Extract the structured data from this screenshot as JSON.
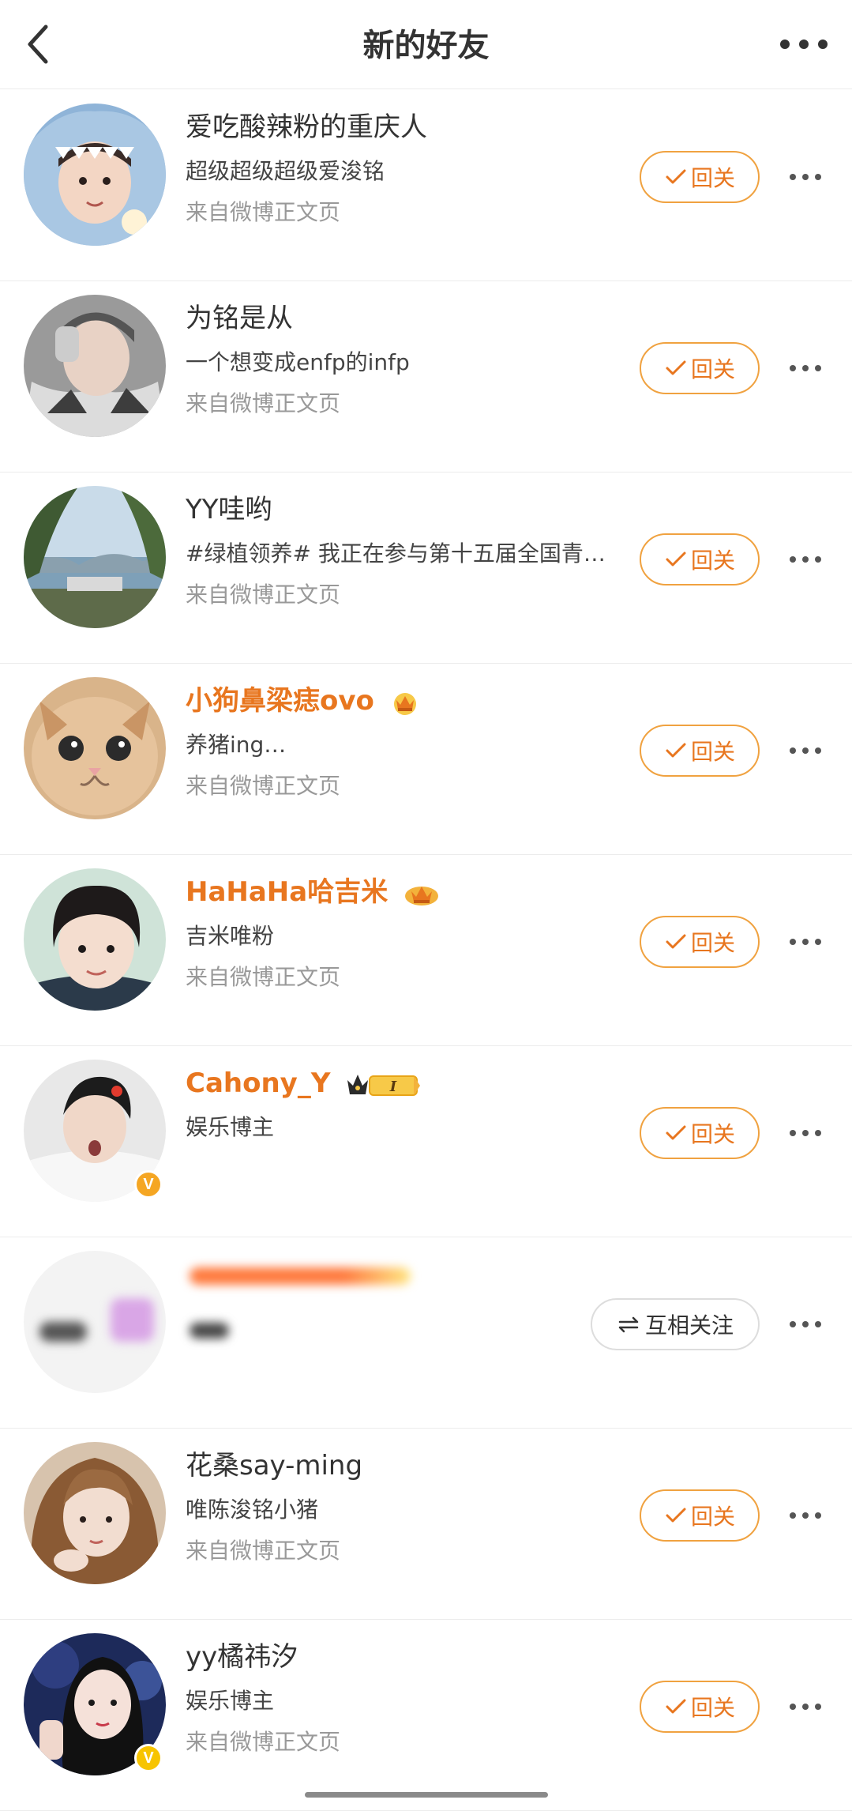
{
  "header": {
    "title": "新的好友",
    "back_icon": "chevron-left-icon",
    "more_icon": "more-dots-icon"
  },
  "colors": {
    "accent": "#e8761f",
    "button_border": "#f0a240",
    "secondary_text": "#999999",
    "divider": "#ececec"
  },
  "friends": [
    {
      "name": "爱吃酸辣粉的重庆人",
      "bio": "超级超级超级爱浚铭",
      "source": "来自微博正文页",
      "button": "回关",
      "vip": false
    },
    {
      "name": "为铭是从",
      "bio": "一个想变成enfp的infp",
      "source": "来自微博正文页",
      "button": "回关",
      "vip": false
    },
    {
      "name": "YY哇哟",
      "bio": "#绿植领养# 我正在参与第十五届全国青…",
      "source": "来自微博正文页",
      "button": "回关",
      "vip": false
    },
    {
      "name": "小狗鼻梁痣ovo",
      "bio": "养猪ing…",
      "source": "来自微博正文页",
      "button": "回关",
      "vip": true
    },
    {
      "name": "HaHaHa哈吉米",
      "bio": "吉米唯粉",
      "source": "来自微博正文页",
      "button": "回关",
      "vip": true
    },
    {
      "name": "Cahony_Y",
      "bio": "娱乐博主",
      "button": "回关",
      "vip": true,
      "level_badge": "I"
    },
    {
      "button": "互相关注",
      "blurred": true
    },
    {
      "name": "花桑say-ming",
      "bio": "唯陈浚铭小猪",
      "source": "来自微博正文页",
      "button": "回关",
      "vip": false
    },
    {
      "name": "yy橘祎汐",
      "bio": "娱乐博主",
      "source": "来自微博正文页",
      "button": "回关",
      "vip": false
    }
  ]
}
